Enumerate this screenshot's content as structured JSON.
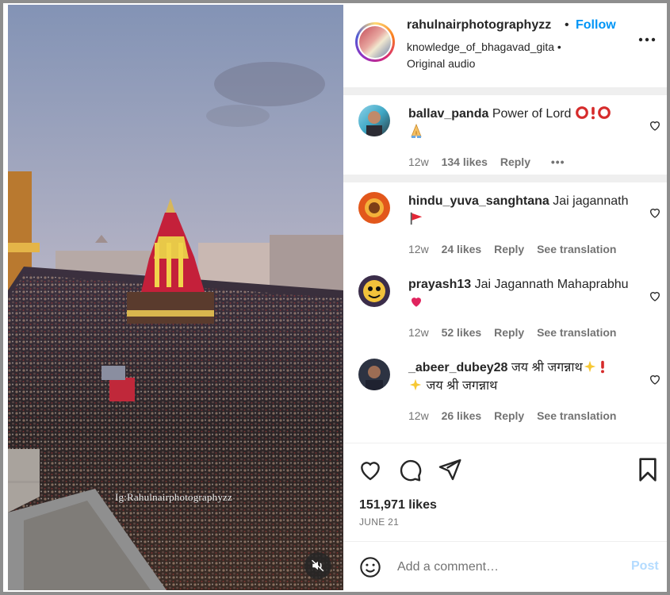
{
  "post": {
    "username": "rahulnairphotographyzz",
    "separator": "•",
    "follow_label": "Follow",
    "tagged_user": "knowledge_of_bhagavad_gita •",
    "audio": "Original audio",
    "watermark": "Ig:Rahulnairphotographyzz",
    "more_icon": "more-horizontal-icon"
  },
  "comments": [
    {
      "user": "ballav_panda",
      "text": "Power of Lord",
      "emoji": [
        "hollow-red-circle",
        "red-exclamation-mark",
        "hollow-red-circle",
        "folded-hands"
      ],
      "age": "12w",
      "likes": "134 likes",
      "reply": "Reply",
      "more": "•••"
    },
    {
      "user": "hindu_yuva_sanghtana",
      "text": "Jai jagannath",
      "emoji": [
        "triangular-flag"
      ],
      "age": "12w",
      "likes": "24 likes",
      "reply": "Reply",
      "translate": "See translation"
    },
    {
      "user": "prayash13",
      "text": "Jai Jagannath Mahaprabhu",
      "emoji": [
        "red-heart"
      ],
      "age": "12w",
      "likes": "52 likes",
      "reply": "Reply",
      "translate": "See translation"
    },
    {
      "user": "_abeer_dubey28",
      "text": "जय श्री जगन्नाथ",
      "text2": "जय श्री जगन्नाथ",
      "emoji": [
        "sparkles",
        "red-exclamation-mark",
        "sparkles"
      ],
      "age": "12w",
      "likes": "26 likes",
      "reply": "Reply",
      "translate": "See translation"
    }
  ],
  "actions": {
    "icons": [
      "heart-icon",
      "comment-icon",
      "share-icon",
      "bookmark-icon"
    ],
    "likes": "151,971 likes",
    "date": "JUNE 21"
  },
  "composer": {
    "placeholder": "Add a comment…",
    "post_label": "Post"
  },
  "colors": {
    "accent": "#0095f6",
    "post_disabled": "#b3dbff",
    "text": "#262626",
    "muted": "#737373",
    "separator": "#efefef"
  }
}
